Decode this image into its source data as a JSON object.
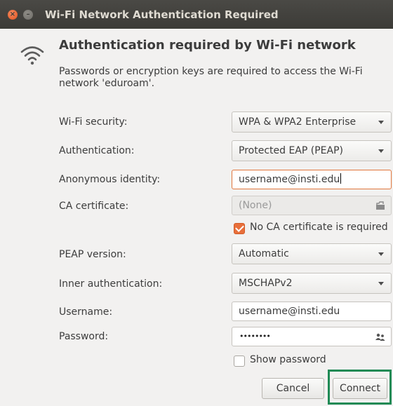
{
  "window": {
    "title": "Wi-Fi Network Authentication Required",
    "close_glyph": "×",
    "minimize_glyph": "–"
  },
  "header": {
    "heading": "Authentication required by Wi-Fi network",
    "description": "Passwords or encryption keys are required to access the Wi-Fi network 'eduroam'.",
    "icon": "wifi-icon"
  },
  "form": {
    "wifi_security": {
      "label": "Wi-Fi security:",
      "value": "WPA & WPA2 Enterprise"
    },
    "authentication": {
      "label": "Authentication:",
      "value": "Protected EAP (PEAP)"
    },
    "anonymous_identity": {
      "label": "Anonymous identity:",
      "value": "username@insti.edu"
    },
    "ca_certificate": {
      "label": "CA certificate:",
      "value": "(None)"
    },
    "no_ca_certificate": {
      "label": "No CA certificate is required",
      "checked": true
    },
    "peap_version": {
      "label": "PEAP version:",
      "value": "Automatic"
    },
    "inner_authentication": {
      "label": "Inner authentication:",
      "value": "MSCHAPv2"
    },
    "username": {
      "label": "Username:",
      "value": "username@insti.edu"
    },
    "password": {
      "label": "Password:",
      "masked_value": "••••••••"
    },
    "show_password": {
      "label": "Show password",
      "checked": false
    }
  },
  "buttons": {
    "cancel": "Cancel",
    "connect": "Connect"
  },
  "colors": {
    "accent": "#e86f3b",
    "titlebar": "#3c3b37",
    "highlight": "#1f8a55"
  }
}
